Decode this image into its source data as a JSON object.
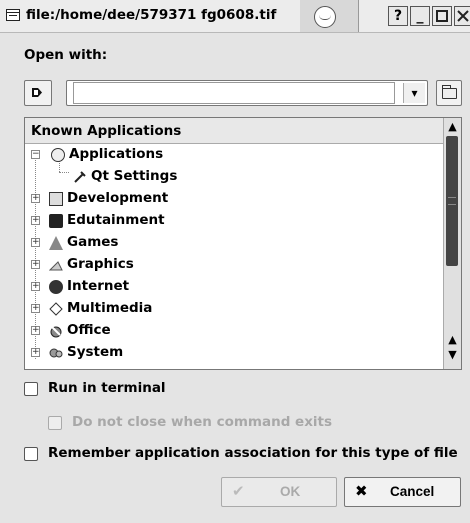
{
  "window": {
    "title": "file:/home/dee/579371 fg0608.tif",
    "buttons": {
      "help": "?",
      "minimize": "_"
    }
  },
  "open_with": {
    "label": "Open with:",
    "input_value": "",
    "dropdown_glyph": "▾"
  },
  "tree": {
    "header": "Known Applications",
    "items": [
      {
        "label": "Applications",
        "icon": "applications-icon",
        "expander": "−"
      },
      {
        "label": "Qt Settings",
        "icon": "qt-settings-icon"
      },
      {
        "label": "Development",
        "icon": "development-icon",
        "expander": "+"
      },
      {
        "label": "Edutainment",
        "icon": "edutainment-icon",
        "expander": "+"
      },
      {
        "label": "Games",
        "icon": "games-icon",
        "expander": "+"
      },
      {
        "label": "Graphics",
        "icon": "graphics-icon",
        "expander": "+"
      },
      {
        "label": "Internet",
        "icon": "internet-icon",
        "expander": "+"
      },
      {
        "label": "Multimedia",
        "icon": "multimedia-icon",
        "expander": "+"
      },
      {
        "label": "Office",
        "icon": "office-icon",
        "expander": "+"
      },
      {
        "label": "System",
        "icon": "system-icon",
        "expander": "+"
      }
    ]
  },
  "options": {
    "run_in_terminal": "Run in terminal",
    "do_not_close": "Do not close when command exits",
    "remember_association": "Remember application association for this type of file"
  },
  "buttons": {
    "ok": "OK",
    "cancel": "Cancel"
  },
  "colors": {
    "background": "#e4e4e4",
    "disabled_text": "#a8a8a8"
  }
}
